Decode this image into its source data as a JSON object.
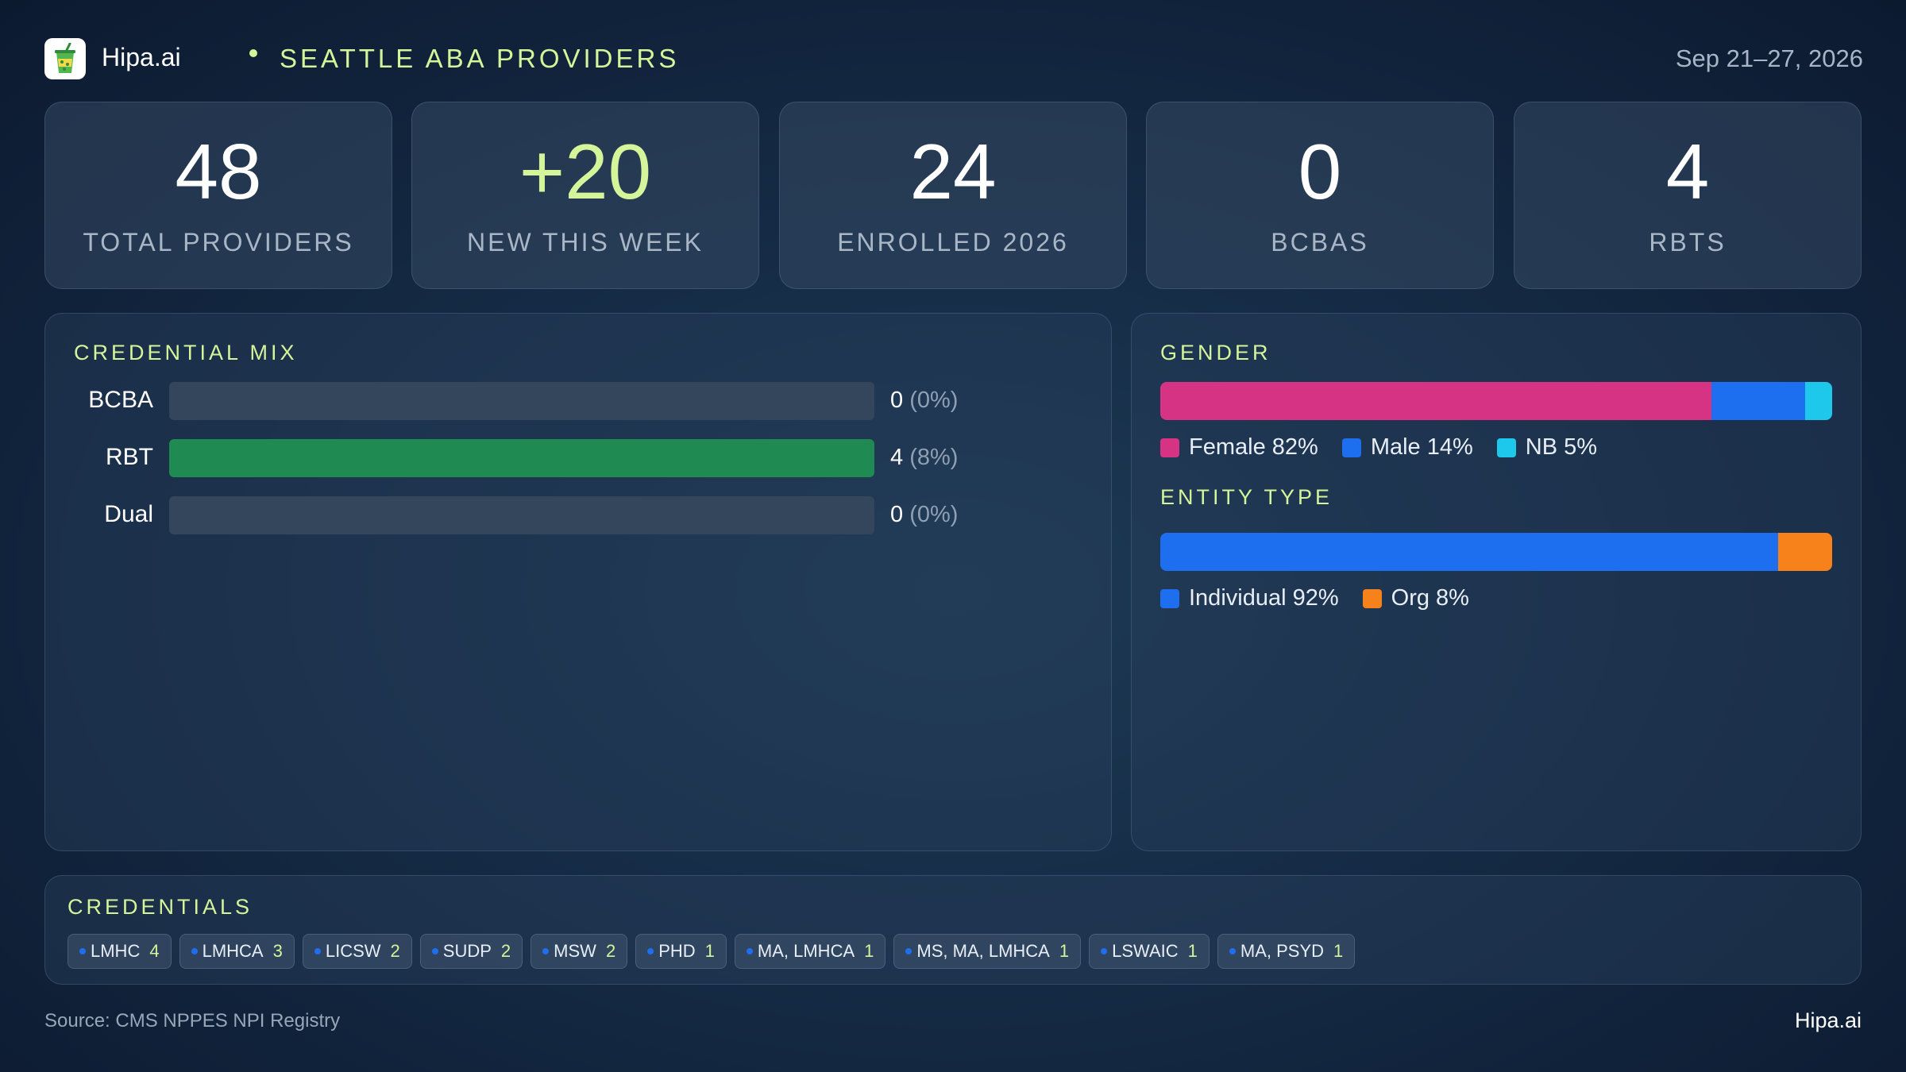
{
  "header": {
    "brand": "Hipa.ai",
    "title": "SEATTLE ABA PROVIDERS",
    "date_range": "Sep 21–27, 2026",
    "logo_icon": "drink-cup-icon"
  },
  "stats": [
    {
      "value": "48",
      "label": "TOTAL PROVIDERS"
    },
    {
      "value": "+20",
      "label": "NEW THIS WEEK"
    },
    {
      "value": "24",
      "label": "ENROLLED 2026"
    },
    {
      "value": "0",
      "label": "BCBAS"
    },
    {
      "value": "4",
      "label": "RBTS"
    }
  ],
  "credential_mix": {
    "title": "CREDENTIAL MIX",
    "rows": [
      {
        "label": "BCBA",
        "count": "0",
        "pct": "(0%)",
        "fill": 0
      },
      {
        "label": "RBT",
        "count": "4",
        "pct": "(8%)",
        "fill": 1
      },
      {
        "label": "Dual",
        "count": "0",
        "pct": "(0%)",
        "fill": 0
      }
    ],
    "fill_color": "#1f8a52"
  },
  "gender": {
    "title": "GENDER",
    "segments": [
      {
        "label": "Female 82%",
        "share": 82,
        "color": "#d63384"
      },
      {
        "label": "Male 14%",
        "share": 14,
        "color": "#1e6ff0"
      },
      {
        "label": "NB 5%",
        "share": 4,
        "color": "#1ec8ea"
      }
    ]
  },
  "entity_type": {
    "title": "ENTITY TYPE",
    "segments": [
      {
        "label": "Individual 92%",
        "share": 92,
        "color": "#1e6ff0"
      },
      {
        "label": "Org 8%",
        "share": 8,
        "color": "#f7821b"
      }
    ]
  },
  "credentials": {
    "title": "CREDENTIALS",
    "chips": [
      {
        "name": "LMHC",
        "count": "4"
      },
      {
        "name": "LMHCA",
        "count": "3"
      },
      {
        "name": "LICSW",
        "count": "2"
      },
      {
        "name": "SUDP",
        "count": "2"
      },
      {
        "name": "MSW",
        "count": "2"
      },
      {
        "name": "PHD",
        "count": "1"
      },
      {
        "name": "MA, LMHCA",
        "count": "1"
      },
      {
        "name": "MS, MA, LMHCA",
        "count": "1"
      },
      {
        "name": "LSWAIC",
        "count": "1"
      },
      {
        "name": "MA, PSYD",
        "count": "1"
      }
    ]
  },
  "footer": {
    "source": "Source: CMS NPPES NPI Registry",
    "brand": "Hipa.ai"
  },
  "colors": {
    "accent": "#d4f59a",
    "background": "#152b45"
  }
}
